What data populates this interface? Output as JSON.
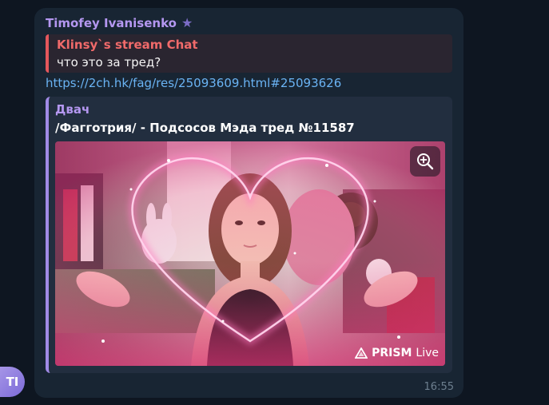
{
  "message": {
    "avatar_initials": "TI",
    "sender": "Timofey Ivanisenko",
    "reply": {
      "name": "Klinsy`s stream Chat",
      "text": "что это за тред?"
    },
    "link": "https://2ch.hk/fag/res/25093609.html#25093626",
    "preview": {
      "site": "Двач",
      "title": "/Фагготрия/ - Подсосов Мэда тред №11587",
      "watermark_brand": "PRISM",
      "watermark_suffix": "Live"
    },
    "time": "16:55"
  },
  "colors": {
    "background": "#0e1621",
    "bubble": "#182533",
    "sender_name": "#b497f0",
    "reply_accent": "#e4575c",
    "link": "#6ab3f3"
  },
  "icons": {
    "sender_badge": "star-icon",
    "preview_action": "zoom-in-icon",
    "watermark": "prism-logo-icon"
  }
}
